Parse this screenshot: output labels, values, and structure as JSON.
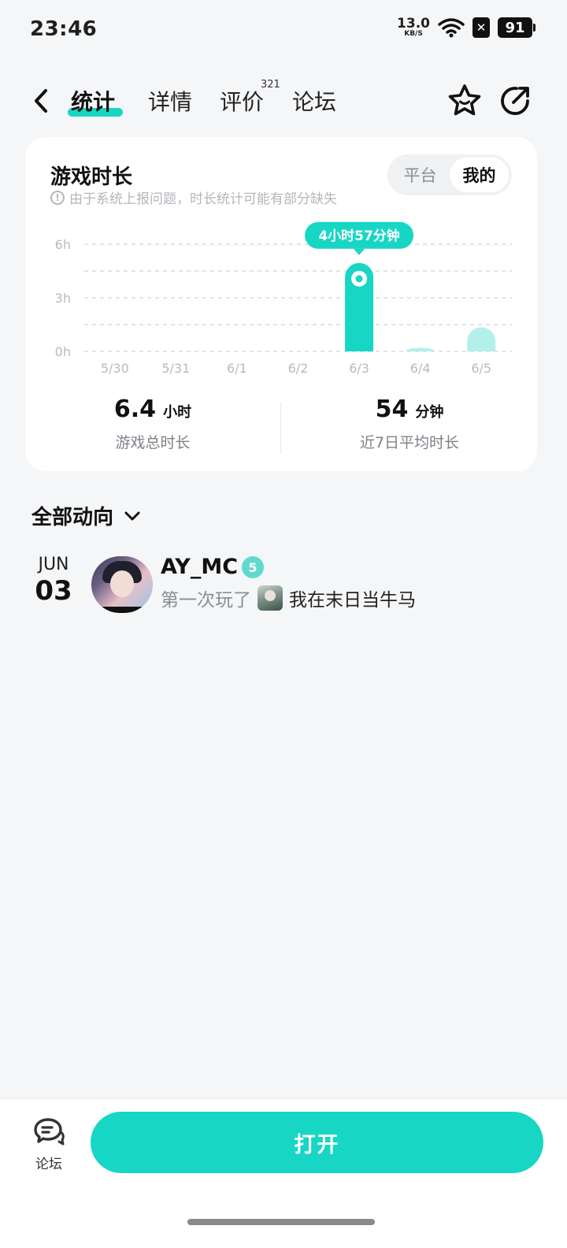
{
  "status_bar": {
    "time": "23:46",
    "net_speed_value": "13.0",
    "net_speed_unit": "KB/S",
    "battery": "91"
  },
  "nav": {
    "tabs": [
      {
        "label": "统计",
        "active": true
      },
      {
        "label": "详情",
        "active": false
      },
      {
        "label": "评价",
        "active": false,
        "count": "321"
      },
      {
        "label": "论坛",
        "active": false
      }
    ],
    "icons": [
      "back-icon",
      "star-icon",
      "share-icon"
    ]
  },
  "stats_card": {
    "title": "游戏时长",
    "note": "由于系统上报问题，时长统计可能有部分缺失",
    "segment": {
      "options": [
        "平台",
        "我的"
      ],
      "selected": "我的"
    },
    "tooltip": "4小时57分钟",
    "total": {
      "value": "6.4",
      "unit": "小时",
      "label": "游戏总时长"
    },
    "average": {
      "value": "54",
      "unit": "分钟",
      "label": "近7日平均时长"
    }
  },
  "chart_data": {
    "type": "bar",
    "categories": [
      "5/30",
      "5/31",
      "6/1",
      "6/2",
      "6/3",
      "6/4",
      "6/5"
    ],
    "values": [
      0,
      0,
      0,
      0,
      4.95,
      0.2,
      1.35
    ],
    "highlight_index": 4,
    "y_ticks": [
      "0h",
      "3h",
      "6h"
    ],
    "ylim": [
      0,
      6
    ],
    "grid": true,
    "colors": {
      "highlight": "#18d6c4",
      "normal": "#b3f0ea",
      "grid": "#d9dcdf",
      "tick": "#b7babf"
    }
  },
  "feed": {
    "header": "全部动向",
    "items": [
      {
        "month": "JUN",
        "day": "03",
        "user": "AY_MC",
        "level": "5",
        "prefix": "第一次玩了",
        "game": "我在末日当牛马"
      }
    ]
  },
  "bottom_bar": {
    "forum_label": "论坛",
    "open_label": "打开"
  },
  "colors": {
    "accent": "#18d6c4",
    "background": "#f5f6f8"
  }
}
